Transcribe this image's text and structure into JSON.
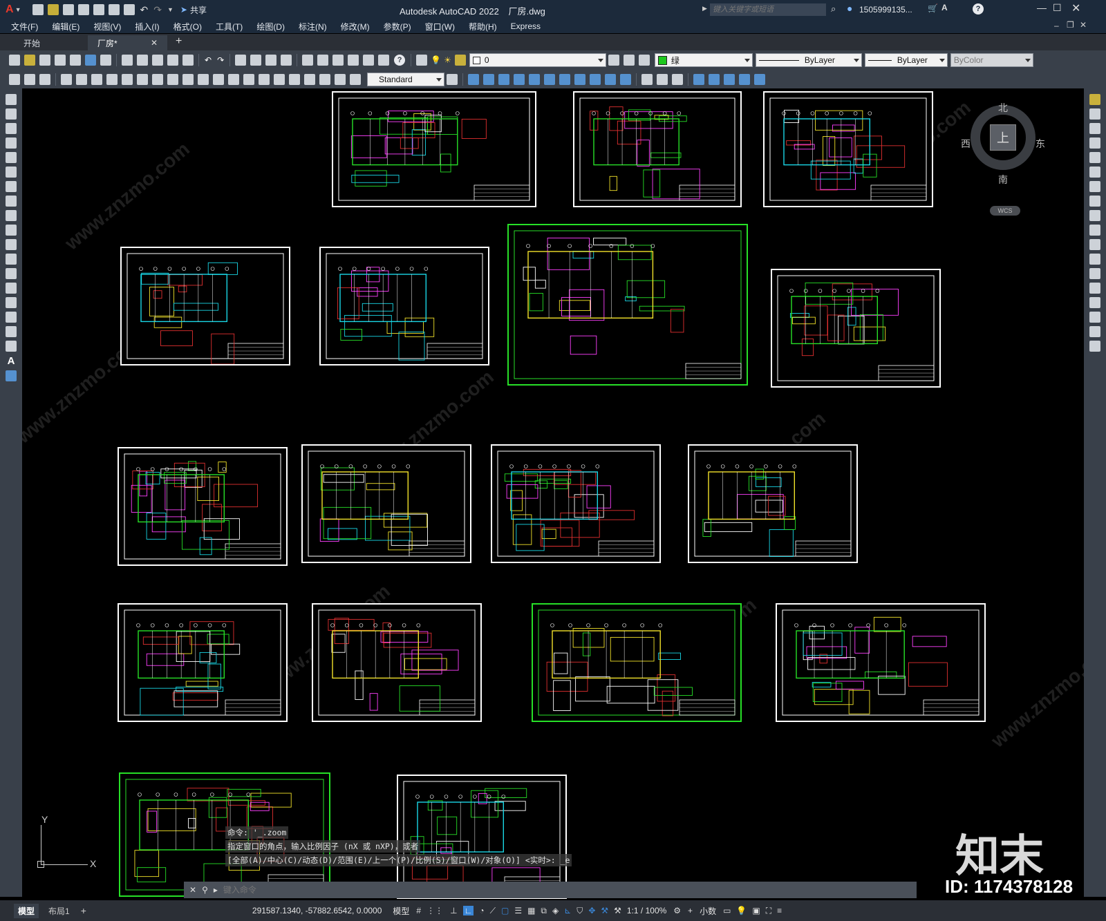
{
  "title_bar": {
    "app_title": "Autodesk AutoCAD 2022",
    "file_name": "厂房.dwg",
    "share_label": "共享",
    "search_placeholder": "键入关键字或短语",
    "user": "1505999135...",
    "window_controls": [
      "minimize",
      "restore",
      "close"
    ]
  },
  "menu": {
    "items": [
      "文件(F)",
      "编辑(E)",
      "视图(V)",
      "插入(I)",
      "格式(O)",
      "工具(T)",
      "绘图(D)",
      "标注(N)",
      "修改(M)",
      "参数(P)",
      "窗口(W)",
      "帮助(H)",
      "Express"
    ]
  },
  "tabs": {
    "items": [
      "开始",
      "厂房*"
    ],
    "active": "厂房*"
  },
  "properties": {
    "layer": "0",
    "color": "绿",
    "color_hex": "#1ec81e",
    "linetype": "ByLayer",
    "lineweight": "ByLayer",
    "plotstyle": "ByColor",
    "text_style": "Standard"
  },
  "viewcube": {
    "north": "北",
    "south": "南",
    "east": "东",
    "west": "西",
    "face": "上",
    "wcs": "WCS"
  },
  "command": {
    "history": [
      "命令: '_.zoom",
      "指定窗口的角点，输入比例因子 (nX 或 nXP)，或者",
      "[全部(A)/中心(C)/动态(D)/范围(E)/上一个(P)/比例(S)/窗口(W)/对象(O)] <实时>: _e"
    ],
    "placeholder": "键入命令"
  },
  "ucs": {
    "x": "X",
    "y": "Y"
  },
  "status": {
    "layout_tabs": [
      "模型",
      "布局1"
    ],
    "coordinates": "291587.1340, -57882.6542, 0.0000",
    "model_label": "模型",
    "scale": "1:1 / 100%",
    "units": "小数"
  },
  "watermark": {
    "brand": "知末",
    "id": "ID: 1174378128",
    "site": "www.znzmo.com"
  }
}
